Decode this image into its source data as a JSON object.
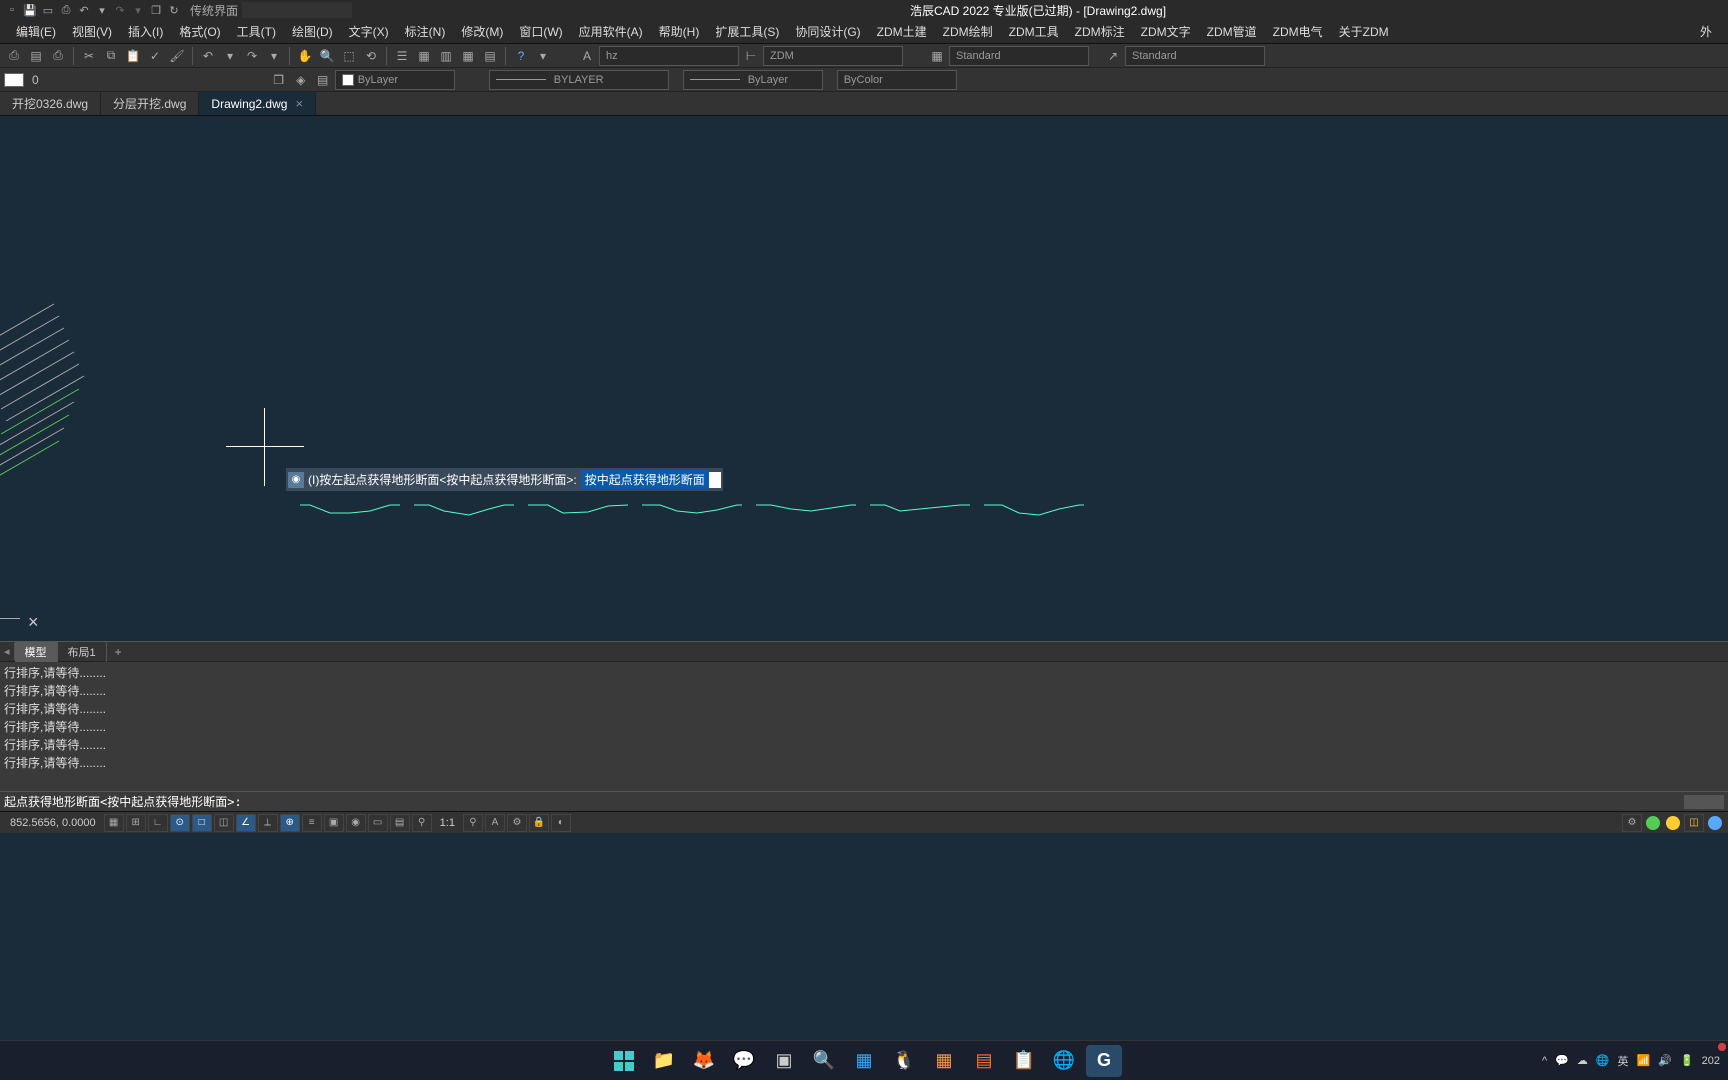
{
  "titlebar": {
    "workspace_label": "传统界面",
    "title": "浩辰CAD 2022 专业版(已过期) - [Drawing2.dwg]"
  },
  "menubar": [
    "编辑(E)",
    "视图(V)",
    "插入(I)",
    "格式(O)",
    "工具(T)",
    "绘图(D)",
    "文字(X)",
    "标注(N)",
    "修改(M)",
    "窗口(W)",
    "应用软件(A)",
    "帮助(H)",
    "扩展工具(S)",
    "协同设计(G)",
    "ZDM土建",
    "ZDM绘制",
    "ZDM工具",
    "ZDM标注",
    "ZDM文字",
    "ZDM管道",
    "ZDM电气",
    "关于ZDM"
  ],
  "menubar_right": "外",
  "tool_row1": {
    "textstyle": "hz",
    "dimstyle": "ZDM",
    "std1": "Standard",
    "std2": "Standard"
  },
  "tool_row2": {
    "layer_swatch_label": "0",
    "linetype": "ByLayer",
    "bylayer": "BYLAYER",
    "color": "ByColor"
  },
  "file_tabs": [
    {
      "label": "开挖0326.dwg",
      "active": false
    },
    {
      "label": "分层开挖.dwg",
      "active": false
    },
    {
      "label": "Drawing2.dwg",
      "active": true
    }
  ],
  "prompt": {
    "label": "(I)按左起点获得地形断面<按中起点获得地形断面>:",
    "value": "按中起点获得地形断面"
  },
  "model_tabs": {
    "model": "模型",
    "layout1": "布局1"
  },
  "cmd_lines": [
    "行排序,请等待........",
    "行排序,请等待........",
    "行排序,请等待........",
    "行排序,请等待........",
    "行排序,请等待........",
    "行排序,请等待........"
  ],
  "cmd_input": "起点获得地形断面<按中起点获得地形断面>:",
  "status": {
    "coords": "852.5656, 0.0000",
    "scale": "1:1",
    "year": "202"
  },
  "tray": {
    "ime": "英",
    "hand": "⌨"
  }
}
